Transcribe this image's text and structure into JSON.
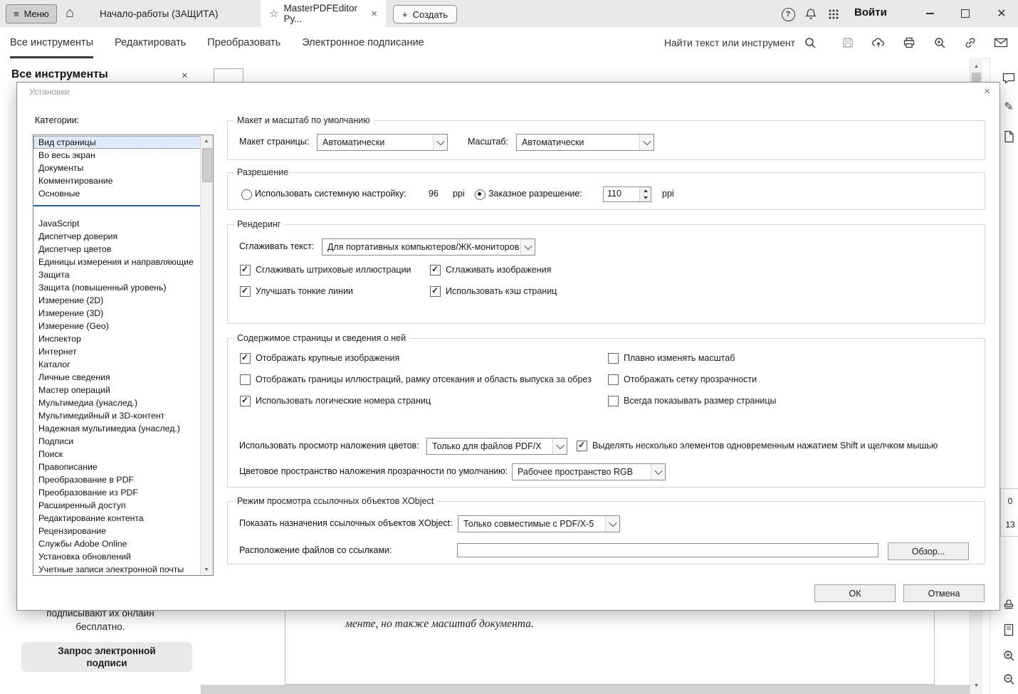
{
  "icons": {
    "hamburger": "≡",
    "home": "⌂",
    "star": "☆",
    "close_x": "×",
    "plus": "+",
    "help": "?",
    "window_close": "✕",
    "pencil": "✎",
    "arrow_up": "▲",
    "arrow_down": "▼"
  },
  "titlebar": {
    "menu_label": "Меню",
    "create_label": "Создать",
    "sign_in_label": "Войти",
    "tabs": [
      {
        "label": "Начало-работы (ЗАЩИТА)"
      },
      {
        "label": "MasterPDFEditor Ру..."
      }
    ]
  },
  "toolbar": {
    "tabs": [
      {
        "label": "Все инструменты"
      },
      {
        "label": "Редактировать"
      },
      {
        "label": "Преобразовать"
      },
      {
        "label": "Электронное подписание"
      }
    ],
    "search_label": "Найти текст или инструмент"
  },
  "left_panel": {
    "title": "Все инструменты",
    "bottom_text_line1": "подписывают их онлайн",
    "bottom_text_line2": "бесплатно.",
    "request_button_line1": "Запрос электронной",
    "request_button_line2": "подписи"
  },
  "document": {
    "visible_text": "менте, но также масштаб документа.",
    "page_fragment_top": "0",
    "page_fragment_bottom": "13"
  },
  "dialog": {
    "title": "Установки",
    "categories_label": "Категории:",
    "selected_category": "Вид страницы",
    "categories_top": [
      "Вид страницы",
      "Во весь экран",
      "Документы",
      "Комментирование",
      "Основные"
    ],
    "categories_rest": [
      "JavaScript",
      "Диспетчер доверия",
      "Диспетчер цветов",
      "Единицы измерения и направляющие",
      "Защита",
      "Защита (повышенный уровень)",
      "Измерение (2D)",
      "Измерение (3D)",
      "Измерение (Geo)",
      "Инспектор",
      "Интернет",
      "Каталог",
      "Личные сведения",
      "Мастер операций",
      "Мультимедиа (унаслед.)",
      "Мультимедийный и 3D-контент",
      "Надежная мультимедиа (унаслед.)",
      "Подписи",
      "Поиск",
      "Правописание",
      "Преобразование в PDF",
      "Преобразование из PDF",
      "Расширенный доступ",
      "Редактирование контента",
      "Рецензирование",
      "Службы Adobe Online",
      "Установка обновлений",
      "Учетные записи электронной почты"
    ],
    "layout_group": {
      "legend": "Макет и масштаб по умолчанию",
      "page_layout_label": "Макет страницы:",
      "page_layout_value": "Автоматически",
      "zoom_label": "Масштаб:",
      "zoom_value": "Автоматически"
    },
    "resolution_group": {
      "legend": "Разрешение",
      "system_option": {
        "label": "Использовать системную настройку:",
        "value": "96",
        "unit": "ppi",
        "selected": false
      },
      "custom_option": {
        "label": "Заказное разрешение:",
        "value": "110",
        "unit": "ppi",
        "selected": true
      }
    },
    "rendering_group": {
      "legend": "Рендеринг",
      "smooth_text_label": "Сглаживать текст:",
      "smooth_text_value": "Для портативных компьютеров/ЖК-мониторов",
      "checkboxes": [
        {
          "label": "Сглаживать штриховые иллюстрации",
          "checked": true
        },
        {
          "label": "Сглаживать изображения",
          "checked": true
        },
        {
          "label": "Улучшать тонкие линии",
          "checked": true
        },
        {
          "label": "Использовать кэш страниц",
          "checked": true
        }
      ]
    },
    "page_content_group": {
      "legend": "Содержимое страницы и сведения о ней",
      "checkboxes": [
        {
          "label": "Отображать крупные изображения",
          "checked": true
        },
        {
          "label": "Плавно изменять масштаб",
          "checked": false
        },
        {
          "label": "Отображать границы иллюстраций, рамку отсекания и область выпуска за обрез",
          "checked": false
        },
        {
          "label": "Отображать сетку прозрачности",
          "checked": false
        },
        {
          "label": "Использовать логические номера страниц",
          "checked": true
        },
        {
          "label": "Всегда показывать размер страницы",
          "checked": false
        }
      ],
      "overprint_label": "Использовать просмотр наложения цветов:",
      "overprint_value": "Только для файлов PDF/X",
      "multiselect_checkbox": {
        "label": "Выделять несколько элементов одновременным нажатием Shift и щелчком мышью",
        "checked": true
      },
      "transparency_label": "Цветовое пространство наложения прозрачности по умолчанию:",
      "transparency_value": "Рабочее пространство RGB"
    },
    "xobject_group": {
      "legend": "Режим просмотра ссылочных объектов XObject",
      "show_label": "Показать назначения ссылочных объектов XObject:",
      "show_value": "Только совместимые с PDF/X-5",
      "location_label": "Расположение файлов со ссылками:",
      "location_value": "",
      "browse_label": "Обзор..."
    },
    "ok_label": "ОК",
    "cancel_label": "Отмена"
  }
}
